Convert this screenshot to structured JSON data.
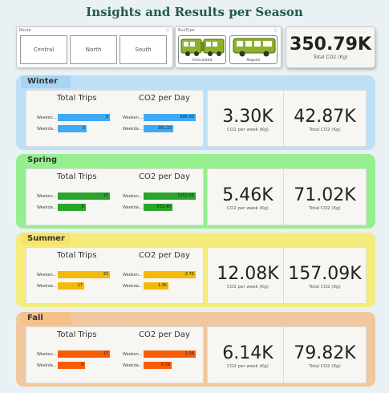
{
  "title": "Insights and Results per Season",
  "route_slicer": {
    "label": "Route",
    "options": [
      "Central",
      "North",
      "South"
    ]
  },
  "bustype_slicer": {
    "label": "BusType",
    "options": [
      "Articulated",
      "Regular"
    ]
  },
  "total": {
    "value": "350.79K",
    "label": "Total CO2 (Kg)"
  },
  "seasons": [
    {
      "name": "Winter",
      "colors": {
        "panel": "#bde0f7",
        "header": "#a8d4f3",
        "bar": "#3fa9f5"
      },
      "trips_title": "Total Trips",
      "co2_title": "CO2 per Day",
      "row_labels": [
        "Weeken...",
        "Weekda..."
      ],
      "trips": {
        "values": [
          9,
          5
        ],
        "labels": [
          "9",
          "5"
        ]
      },
      "co2": {
        "values": [
          696.0,
          391.1
        ],
        "labels": [
          "696.00",
          "391.10"
        ]
      },
      "weekly": {
        "value": "3.30K",
        "label": "CO2 per week (Kg)"
      },
      "total": {
        "value": "42.87K",
        "label": "Total CO2 (Kg)"
      }
    },
    {
      "name": "Spring",
      "colors": {
        "panel": "#96ef8e",
        "header": "#96ef8e",
        "bar": "#2aa52c"
      },
      "trips_title": "Total Trips",
      "co2_title": "CO2 per Day",
      "row_labels": [
        "Weeken...",
        "Weekda..."
      ],
      "trips": {
        "values": [
          15,
          8
        ],
        "labels": [
          "15",
          "8"
        ]
      },
      "co2": {
        "values": [
          1152.0,
          631.4
        ],
        "labels": [
          "1152.00",
          "631.40"
        ]
      },
      "weekly": {
        "value": "5.46K",
        "label": "CO2 per week (Kg)"
      },
      "total": {
        "value": "71.02K",
        "label": "Total CO2 (Kg)"
      }
    },
    {
      "name": "Summer",
      "colors": {
        "panel": "#f4ec7d",
        "header": "#f8e36a",
        "bar": "#f3b90b"
      },
      "trips_title": "Total Trips",
      "co2_title": "CO2 per Day",
      "row_labels": [
        "Weeken...",
        "Weekda..."
      ],
      "trips": {
        "values": [
          33,
          17
        ],
        "labels": [
          "33",
          "17"
        ]
      },
      "co2": {
        "values": [
          2700,
          1300
        ],
        "labels": [
          "2.7K",
          "1.3K"
        ]
      },
      "weekly": {
        "value": "12.08K",
        "label": "CO2 per week (Kg)"
      },
      "total": {
        "value": "157.09K",
        "label": "Total CO2 (Kg)"
      }
    },
    {
      "name": "Fall",
      "colors": {
        "panel": "#f1c79d",
        "header": "#f5c08a",
        "bar": "#f95c06"
      },
      "trips_title": "Total Trips",
      "co2_title": "CO2 per Day",
      "row_labels": [
        "Weeken...",
        "Weekda..."
      ],
      "trips": {
        "values": [
          17,
          9
        ],
        "labels": [
          "17",
          "9"
        ]
      },
      "co2": {
        "values": [
          1300,
          700
        ],
        "labels": [
          "1.3K",
          "0.7K"
        ]
      },
      "weekly": {
        "value": "6.14K",
        "label": "CO2 per week (Kg)"
      },
      "total": {
        "value": "79.82K",
        "label": "Total CO2 (Kg)"
      }
    }
  ]
}
